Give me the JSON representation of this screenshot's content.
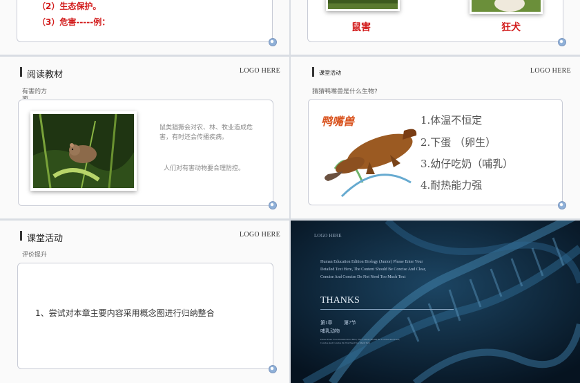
{
  "slide1": {
    "lines": [
      "（2）生态保护。",
      "（3）危害-----例："
    ]
  },
  "slide2": {
    "captions": [
      "鼠害",
      "狂犬"
    ]
  },
  "slide3": {
    "title": "阅读教材",
    "logo": "LOGO HERE",
    "subtitle_line1": "有害的方",
    "subtitle_line2": "面",
    "text1": "鼠类猖獗会对农、林、牧业造成危害，有时还会传播疾病。",
    "text2": "人们对有害动物要合理防控。"
  },
  "slide4": {
    "title": "课堂活动",
    "logo": "LOGO HERE",
    "question": "猜猜鸭嘴兽是什么生物?",
    "animal_label": "鸭嘴兽",
    "items": [
      "1.体温不恒定",
      "2.下蛋  （卵生）",
      "3.幼仔吃奶（哺乳）",
      "4.耐热能力强"
    ]
  },
  "slide5": {
    "title": "课堂活动",
    "logo": "LOGO HERE",
    "subtitle": "评价提升",
    "body": "1、尝试对本章主要内容采用概念图进行归纳整合"
  },
  "slide6": {
    "logo": "LOGO HERE",
    "intro_line1": "Human Education Edition Biology (Junior) Please Enter Your",
    "intro_line2": "Detailed Text Here, The Content Should Be Concise And Clear,",
    "intro_line3": "Concise And Concise Do Not Need Too Much Text",
    "thanks": "THANKS",
    "chapter": "第1章",
    "section": "第7节",
    "topic": "哺乳动物",
    "small_line1": "Please Enter Your Detailed Text Here, The Content Should Be Concise And Clear,",
    "small_line2": "Concise And Concise Do Not Need Too Much Text"
  },
  "colors": {
    "accent_red": "#d21b1b",
    "frame_border": "#c9ccd6",
    "dark_bg": "#071624"
  },
  "icons": [
    "corner-orb-icon",
    "title-bar-icon",
    "dna-helix-icon"
  ]
}
